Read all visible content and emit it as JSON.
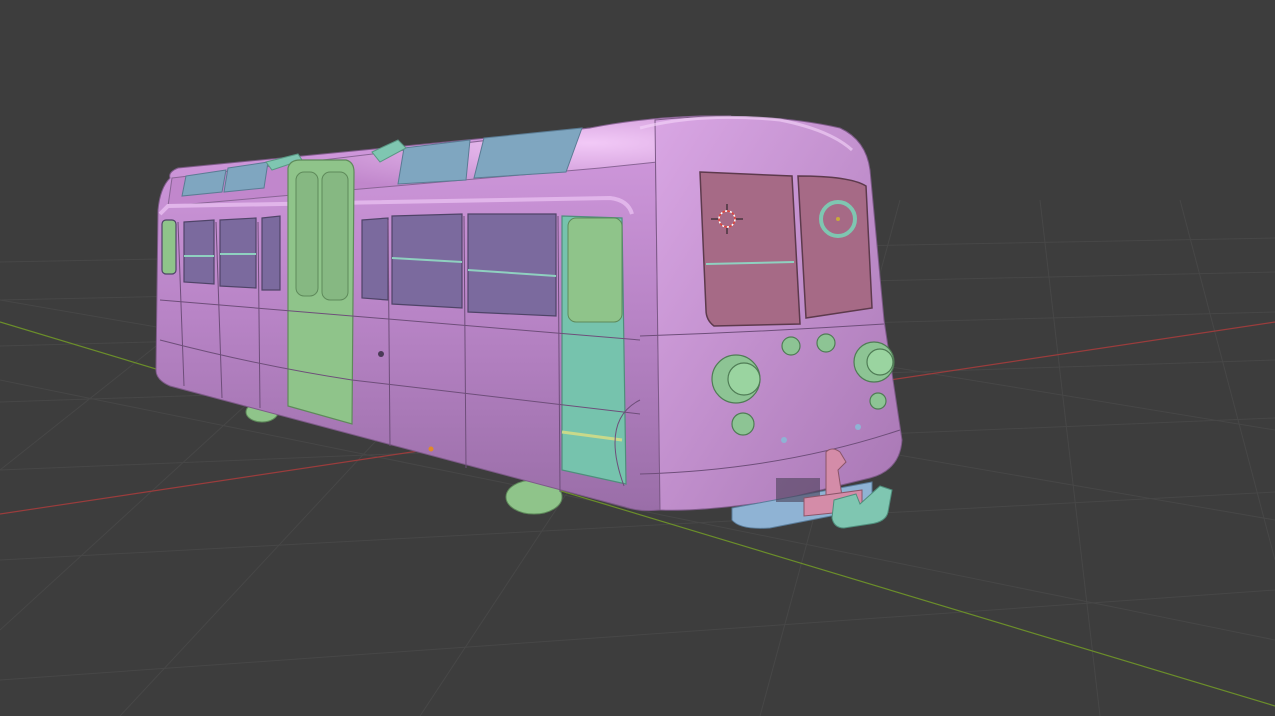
{
  "viewport": {
    "background": "#3d3d3d",
    "grid_color": "#494949",
    "x_axis_color": "#9a3c3c",
    "y_axis_color": "#6b8e2a"
  },
  "scene": {
    "object": "tram",
    "material_colors": {
      "body": "#c187cc",
      "body_shade": "#a877b4",
      "roof_glass": "#7fa6c0",
      "window": "#7b6a9e",
      "door": "#8fc48a",
      "front_door": "#76c3ad",
      "cab_window": "#a66a86",
      "lamp": "#8dc494",
      "coupler": "#7fc6b1",
      "bumper": "#8fb3d4",
      "hook": "#d48ca8"
    },
    "cursor": "3d-cursor"
  }
}
